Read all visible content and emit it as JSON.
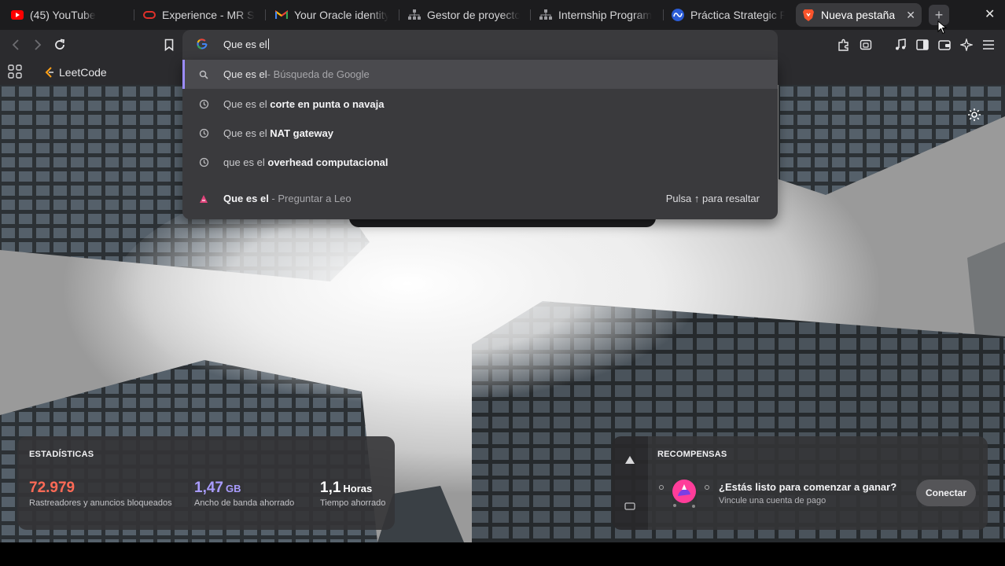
{
  "tabs": [
    {
      "title": "(45) YouTube",
      "icon": "youtube-icon"
    },
    {
      "title": "Experience - MR Stu",
      "icon": "oracle-icon"
    },
    {
      "title": "Your Oracle identity",
      "icon": "gmail-icon"
    },
    {
      "title": "Gestor de proyectos",
      "icon": "sitemap-icon"
    },
    {
      "title": "Internship Program",
      "icon": "sitemap-icon"
    },
    {
      "title": "Práctica Strategic P",
      "icon": "meta-icon"
    },
    {
      "title": "Nueva pestaña",
      "icon": "brave-icon",
      "active": true
    }
  ],
  "omnibox": {
    "value": "Que es el"
  },
  "bookmarks": [
    {
      "label": "LeetCode",
      "icon": "leetcode-icon"
    }
  ],
  "suggestions": [
    {
      "icon": "search-icon",
      "prefix": "Que es el",
      "bold": "",
      "sub": " - Búsqueda de Google",
      "selected": true
    },
    {
      "icon": "history-icon",
      "prefix": "Que es el ",
      "bold": "corte en punta o navaja",
      "sub": ""
    },
    {
      "icon": "history-icon",
      "prefix": "Que es el ",
      "bold": "NAT gateway",
      "sub": ""
    },
    {
      "icon": "history-icon",
      "prefix": "que es el ",
      "bold": "overhead computacional",
      "sub": ""
    },
    {
      "icon": "leo-icon",
      "prefix": "",
      "bold": "Que es el",
      "sub": " - Preguntar a Leo",
      "hint": "Pulsa ↑ para resaltar"
    }
  ],
  "stats": {
    "title": "ESTADÍSTICAS",
    "items": [
      {
        "value": "72.979",
        "unit": "",
        "label": "Rastreadores y anuncios bloqueados",
        "color": "#ff6a56"
      },
      {
        "value": "1,47",
        "unit": "GB",
        "label": "Ancho de banda ahorrado",
        "color": "#a99cff"
      },
      {
        "value": "1,1",
        "unit": "Horas",
        "label": "Tiempo ahorrado",
        "color": "#ffffff"
      }
    ]
  },
  "rewards": {
    "title": "RECOMPENSAS",
    "question": "¿Estás listo para comenzar a ganar?",
    "subtitle": "Vincule una cuenta de pago",
    "button": "Conectar"
  },
  "colors": {
    "accent": "#9b8cff",
    "blocked": "#ff6a56",
    "brave": "#fb542b"
  }
}
